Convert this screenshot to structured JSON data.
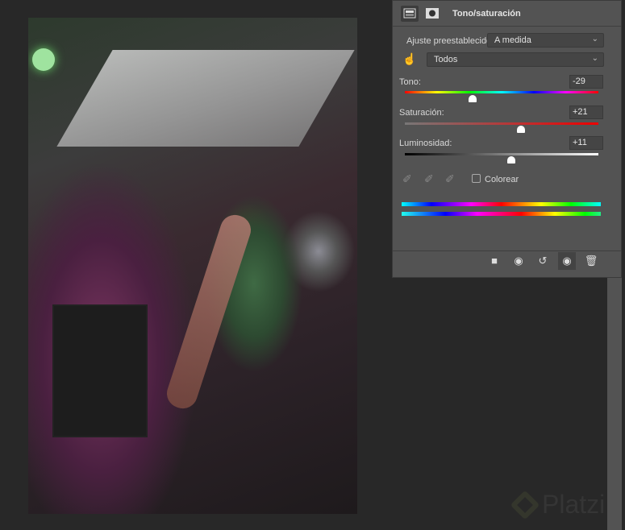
{
  "panel": {
    "title": "Tono/saturación",
    "preset_label": "Ajuste preestablecido:",
    "preset_value": "A medida",
    "channel_value": "Todos",
    "hue": {
      "label": "Tono:",
      "value": "-29"
    },
    "saturation": {
      "label": "Saturación:",
      "value": "+21"
    },
    "lightness": {
      "label": "Luminosidad:",
      "value": "+11"
    },
    "colorize_label": "Colorear",
    "colorize_checked": false
  },
  "watermark": "Platzi"
}
